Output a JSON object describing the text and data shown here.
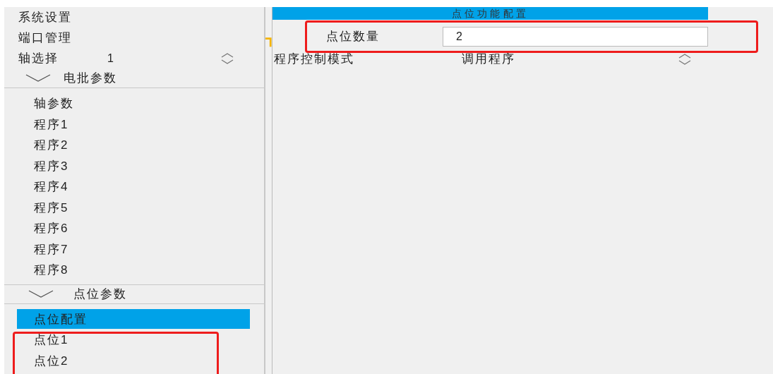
{
  "sidebar": {
    "top_items": [
      {
        "label": "系统设置"
      },
      {
        "label": "端口管理"
      }
    ],
    "axis_select": {
      "label": "轴选择",
      "value": "1"
    },
    "groups": [
      {
        "title": "电批参数",
        "expanded": true,
        "children": [
          {
            "label": "轴参数",
            "selected": false
          },
          {
            "label": "程序1",
            "selected": false
          },
          {
            "label": "程序2",
            "selected": false
          },
          {
            "label": "程序3",
            "selected": false
          },
          {
            "label": "程序4",
            "selected": false
          },
          {
            "label": "程序5",
            "selected": false
          },
          {
            "label": "程序6",
            "selected": false
          },
          {
            "label": "程序7",
            "selected": false
          },
          {
            "label": "程序8",
            "selected": false
          }
        ]
      },
      {
        "title": "点位参数",
        "expanded": true,
        "children": [
          {
            "label": "点位配置",
            "selected": true
          },
          {
            "label": "点位1",
            "selected": false
          },
          {
            "label": "点位2",
            "selected": false
          }
        ]
      }
    ]
  },
  "main": {
    "title": "点位功能配置",
    "point_count": {
      "label": "点位数量",
      "value": "2"
    },
    "control_mode": {
      "label": "程序控制模式",
      "value": "调用程序"
    }
  }
}
